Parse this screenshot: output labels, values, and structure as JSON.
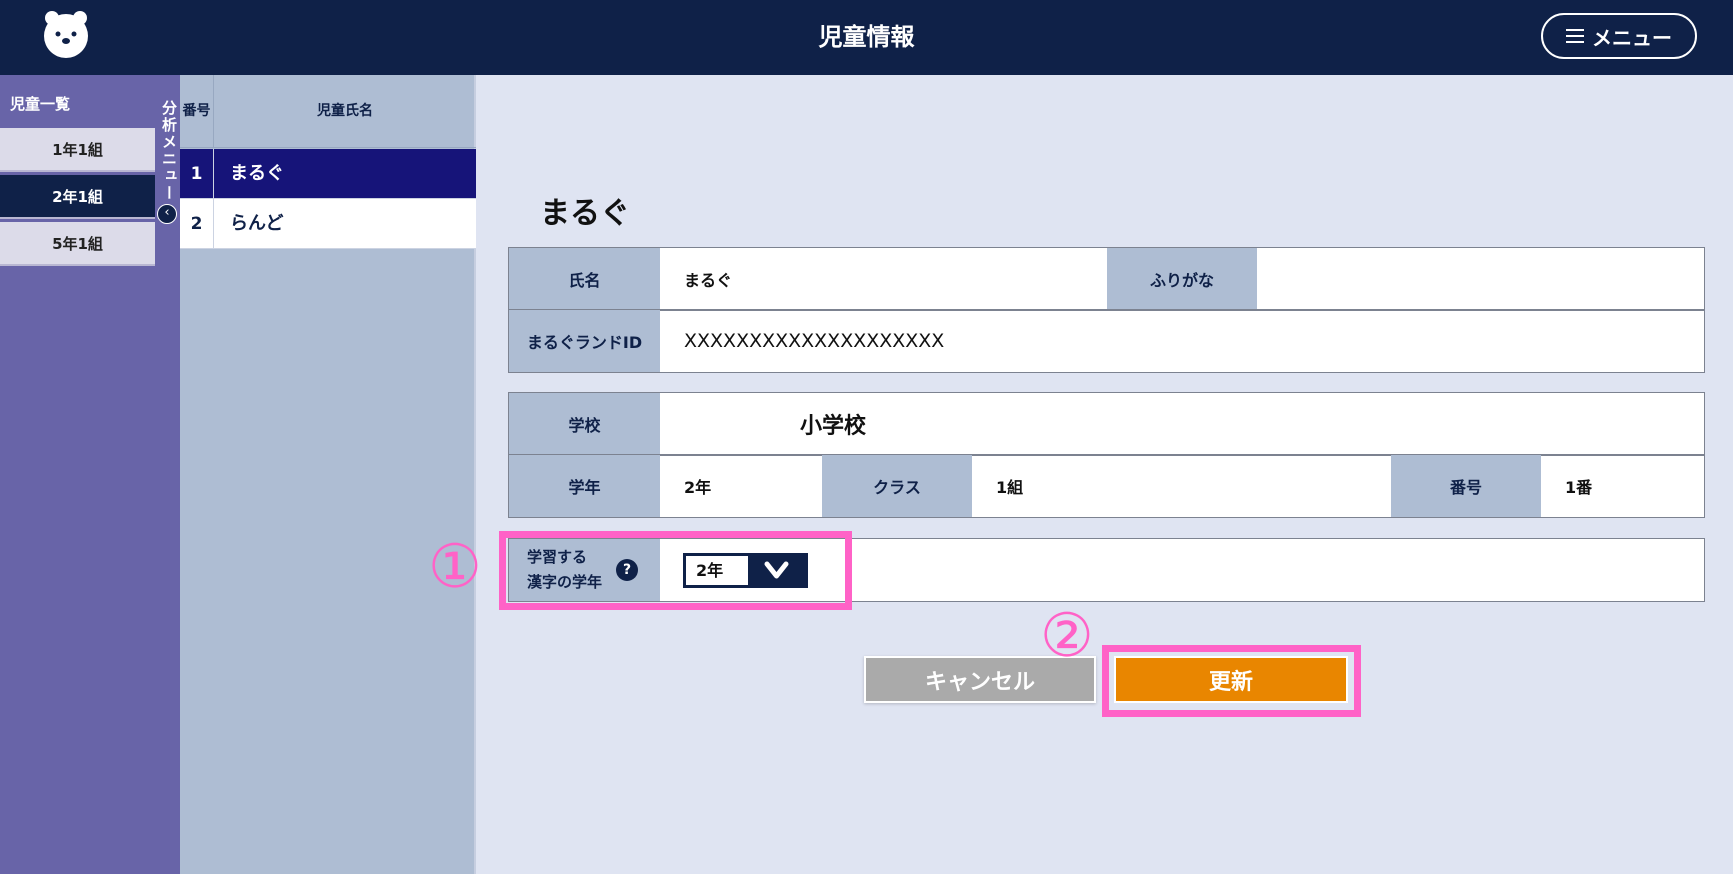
{
  "header": {
    "title": "児童情報",
    "menu_label": "メニュー"
  },
  "sidebar": {
    "title": "児童一覧",
    "classes": [
      {
        "label": "1年1組",
        "active": false
      },
      {
        "label": "2年1組",
        "active": true
      },
      {
        "label": "5年1組",
        "active": false
      }
    ],
    "analysis_tab": "分析メニュー"
  },
  "student_list": {
    "col_no": "番号",
    "col_name": "児童氏名",
    "rows": [
      {
        "no": "1",
        "name": "まるぐ",
        "active": true
      },
      {
        "no": "2",
        "name": "らんど",
        "active": false
      }
    ]
  },
  "detail": {
    "student_name": "まるぐ",
    "name_label": "氏名",
    "name_value": "まるぐ",
    "furigana_label": "ふりがな",
    "furigana_value": "",
    "id_label": "まるぐランドID",
    "id_value": "XXXXXXXXXXXXXXXXXXXX",
    "school_label": "学校",
    "school_value": "小学校",
    "grade_label": "学年",
    "grade_value": "2年",
    "class_label": "クラス",
    "class_value": "1組",
    "number_label": "番号",
    "number_value": "1番",
    "kanji_grade_label_line1": "学習する",
    "kanji_grade_label_line2": "漢字の学年",
    "kanji_grade_value": "2年",
    "help_glyph": "?"
  },
  "actions": {
    "cancel_label": "キャンセル",
    "update_label": "更新"
  },
  "annotations": {
    "marker1": "①",
    "marker2": "②"
  },
  "colors": {
    "navy": "#0f2148",
    "accent_orange": "#e98600",
    "highlight_pink": "#ff62c7",
    "sidebar_purple": "#6864a8"
  }
}
